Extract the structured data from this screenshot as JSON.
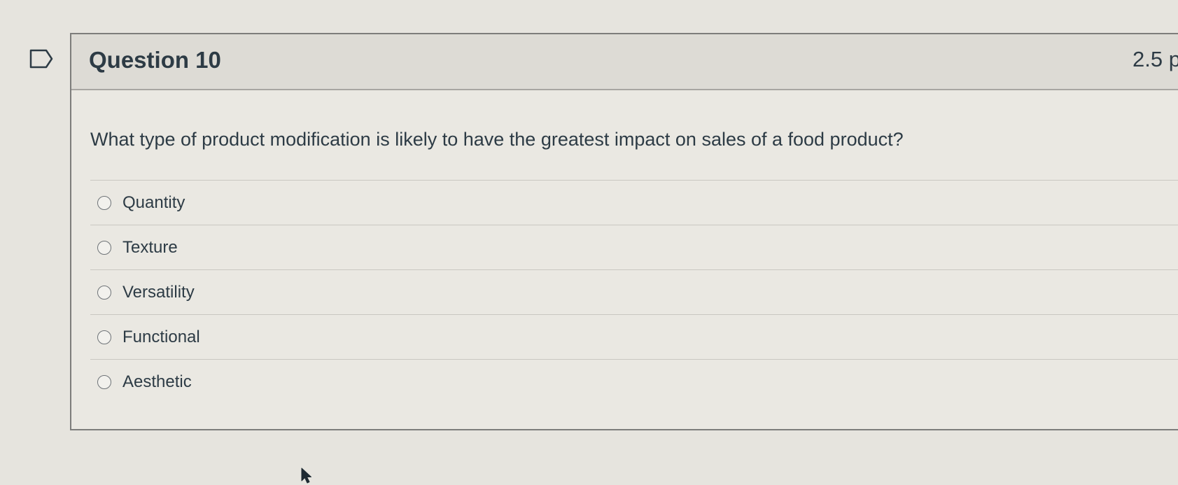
{
  "question": {
    "title": "Question 10",
    "points": "2.5 p",
    "text": "What type of product modification is likely to have the greatest impact on sales of a food product?",
    "answers": [
      {
        "label": "Quantity",
        "selected": false
      },
      {
        "label": "Texture",
        "selected": false
      },
      {
        "label": "Versatility",
        "selected": false
      },
      {
        "label": "Functional",
        "selected": false
      },
      {
        "label": "Aesthetic",
        "selected": false
      }
    ]
  },
  "icons": {
    "flag": "flag-question-icon",
    "cursor": "mouse-pointer-icon"
  },
  "colors": {
    "text": "#2d3b45",
    "header_bg": "#dddbd5",
    "body_bg": "#eae8e2",
    "page_bg": "#e6e4de"
  }
}
